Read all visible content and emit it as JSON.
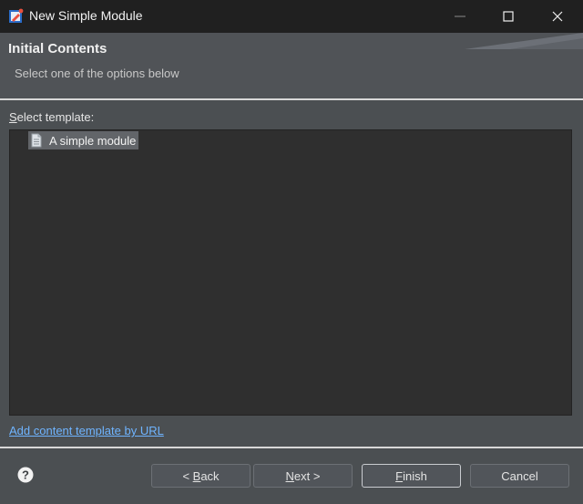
{
  "window": {
    "title": "New Simple Module",
    "icon": "app-icon",
    "controls": [
      "minimize-icon",
      "maximize-icon",
      "close-icon"
    ]
  },
  "banner": {
    "title": "Initial Contents",
    "description": "Select one of the options below"
  },
  "template": {
    "label_mnemonic": "S",
    "label_rest": "elect template:",
    "items": [
      {
        "label": "A simple module",
        "icon": "file-icon",
        "selected": true
      }
    ]
  },
  "link": {
    "label": "Add content template by URL"
  },
  "buttons": {
    "back_prefix": "< ",
    "back_mnemonic": "B",
    "back_rest": "ack",
    "next_mnemonic": "N",
    "next_rest": "ext >",
    "finish_mnemonic": "F",
    "finish_rest": "inish",
    "cancel": "Cancel"
  },
  "colors": {
    "link": "#6fb4ff",
    "titlebar": "#202020",
    "background": "#4b4f52",
    "tree_background": "#2f2f2f"
  }
}
